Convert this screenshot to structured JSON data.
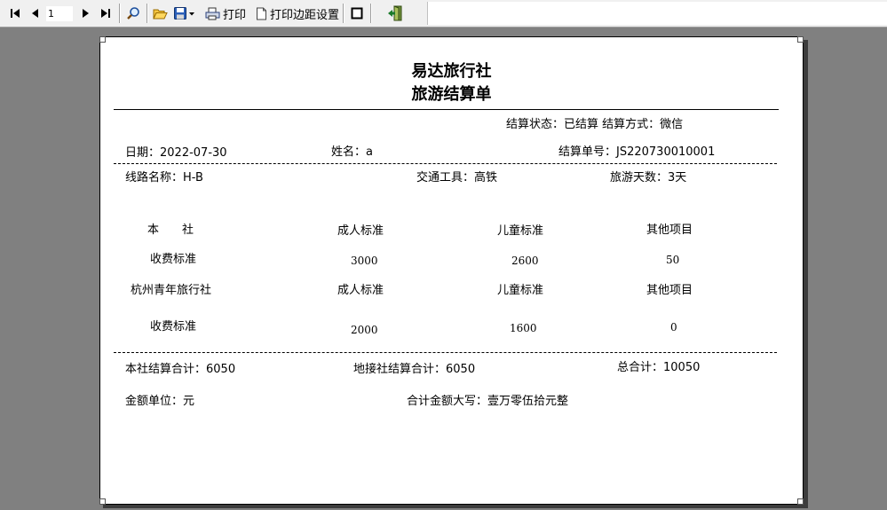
{
  "toolbar": {
    "page_number": "1",
    "print_label": "打印",
    "margin_label": "打印边距设置"
  },
  "report": {
    "title1": "易达旅行社",
    "title2": "旅游结算单",
    "status_line": "结算状态：已结算   结算方式：微信",
    "date": "日期：2022-07-30",
    "name": "姓名：a",
    "order_no": "结算单号：JS220730010001",
    "route": "线路名称：H-B",
    "transport": "交通工具：高铁",
    "days": "旅游天数：3天",
    "fees": {
      "columns": [
        "成人标准",
        "儿童标准",
        "其他项目"
      ],
      "own": {
        "agency": "本　　社",
        "row_label": "收费标准",
        "values": [
          "3000",
          "2600",
          "50"
        ]
      },
      "partner": {
        "agency": "杭州青年旅行社",
        "row_label": "收费标准",
        "values": [
          "2000",
          "1600",
          "0"
        ]
      }
    },
    "own_total": "本社结算合计：6050",
    "partner_total": "地接社结算合计：6050",
    "grand_total": "总合计：10050",
    "currency": "金额单位：元",
    "amount_words": "合计金额大写：壹万零伍拾元整"
  }
}
